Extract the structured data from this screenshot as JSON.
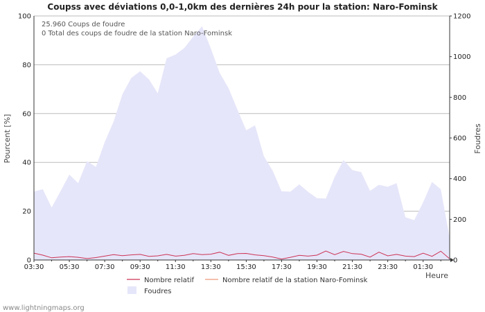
{
  "chart_data": {
    "type": "area",
    "title": "Coupss avec déviations 0,0-1,0km des dernières 24h pour la station: Naro-Fominsk",
    "ylabel_left": "Pourcent   [%]",
    "ylabel_right": "Foudres",
    "xlabel": "Heure",
    "info_lines": [
      "25.960  Coups de foudre",
      "0 Total des coups de foudre de la station Naro-Fominsk"
    ],
    "ylim_left": [
      0,
      100
    ],
    "ylim_right": [
      0,
      1200
    ],
    "yticks_left": [
      "0",
      "20",
      "40",
      "60",
      "80",
      "100"
    ],
    "yticks_right": [
      "0",
      "200",
      "400",
      "600",
      "800",
      "1000",
      "1200"
    ],
    "x_tick_labels": [
      "03:30",
      "05:30",
      "07:30",
      "09:30",
      "11:30",
      "13:30",
      "15:30",
      "17:30",
      "19:30",
      "21:30",
      "23:30",
      "01:30"
    ],
    "x_range_hours": [
      0,
      23.5
    ],
    "grid": true,
    "legend": [
      {
        "label": "Nombre relatif",
        "kind": "line",
        "color": "#cc3355"
      },
      {
        "label": "Nombre relatif de la station Naro-Fominsk",
        "kind": "line",
        "color": "#ee9977"
      },
      {
        "label": "Foudres",
        "kind": "area",
        "color": "#e6e6fa"
      }
    ],
    "series": [
      {
        "name": "Foudres",
        "axis": "right",
        "color": "#e6e6fa",
        "x": [
          0,
          0.5,
          1,
          1.5,
          2,
          2.5,
          3,
          3.5,
          4,
          4.5,
          5,
          5.5,
          6,
          6.5,
          7,
          7.5,
          8,
          8.5,
          9,
          9.5,
          10,
          10.5,
          11,
          11.5,
          12,
          12.5,
          13,
          13.5,
          14,
          14.5,
          15,
          15.5,
          16,
          16.5,
          17,
          17.5,
          18,
          18.5,
          19,
          19.5,
          20,
          20.5,
          21,
          21.5,
          22,
          22.5,
          23,
          23.5
        ],
        "values": [
          336,
          348,
          258,
          338,
          420,
          378,
          486,
          458,
          580,
          680,
          815,
          895,
          928,
          888,
          820,
          992,
          1010,
          1042,
          1098,
          1150,
          1040,
          920,
          845,
          740,
          638,
          662,
          510,
          438,
          338,
          336,
          372,
          335,
          304,
          302,
          408,
          492,
          442,
          432,
          340,
          370,
          360,
          378,
          210,
          196,
          284,
          384,
          348,
          108
        ]
      },
      {
        "name": "Nombre relatif",
        "axis": "left",
        "color": "#cc3355",
        "x": [
          0,
          0.5,
          1,
          1.5,
          2,
          2.5,
          3,
          3.5,
          4,
          4.5,
          5,
          5.5,
          6,
          6.5,
          7,
          7.5,
          8,
          8.5,
          9,
          9.5,
          10,
          10.5,
          11,
          11.5,
          12,
          12.5,
          13,
          13.5,
          14,
          14.5,
          15,
          15.5,
          16,
          16.5,
          17,
          17.5,
          18,
          18.5,
          19,
          19.5,
          20,
          20.5,
          21,
          21.5,
          22,
          22.5,
          23,
          23.5
        ],
        "values": [
          2.8,
          2.0,
          0.9,
          1.2,
          1.4,
          1.1,
          0.6,
          1.0,
          1.6,
          2.2,
          1.8,
          2.1,
          2.3,
          1.5,
          1.7,
          2.3,
          1.6,
          1.9,
          2.6,
          2.2,
          2.4,
          3.2,
          1.9,
          2.6,
          2.7,
          2.1,
          1.8,
          1.2,
          0.4,
          1.1,
          1.9,
          1.6,
          2.0,
          3.7,
          2.2,
          3.5,
          2.6,
          2.4,
          1.2,
          3.2,
          1.7,
          2.3,
          1.6,
          1.4,
          2.8,
          1.5,
          3.6,
          0.5
        ]
      },
      {
        "name": "Nombre relatif de la station Naro-Fominsk",
        "axis": "left",
        "color": "#ee9977",
        "x": [
          0,
          23.5
        ],
        "values": [
          0,
          0
        ]
      }
    ]
  },
  "footer": {
    "credit": "www.lightningmaps.org"
  }
}
